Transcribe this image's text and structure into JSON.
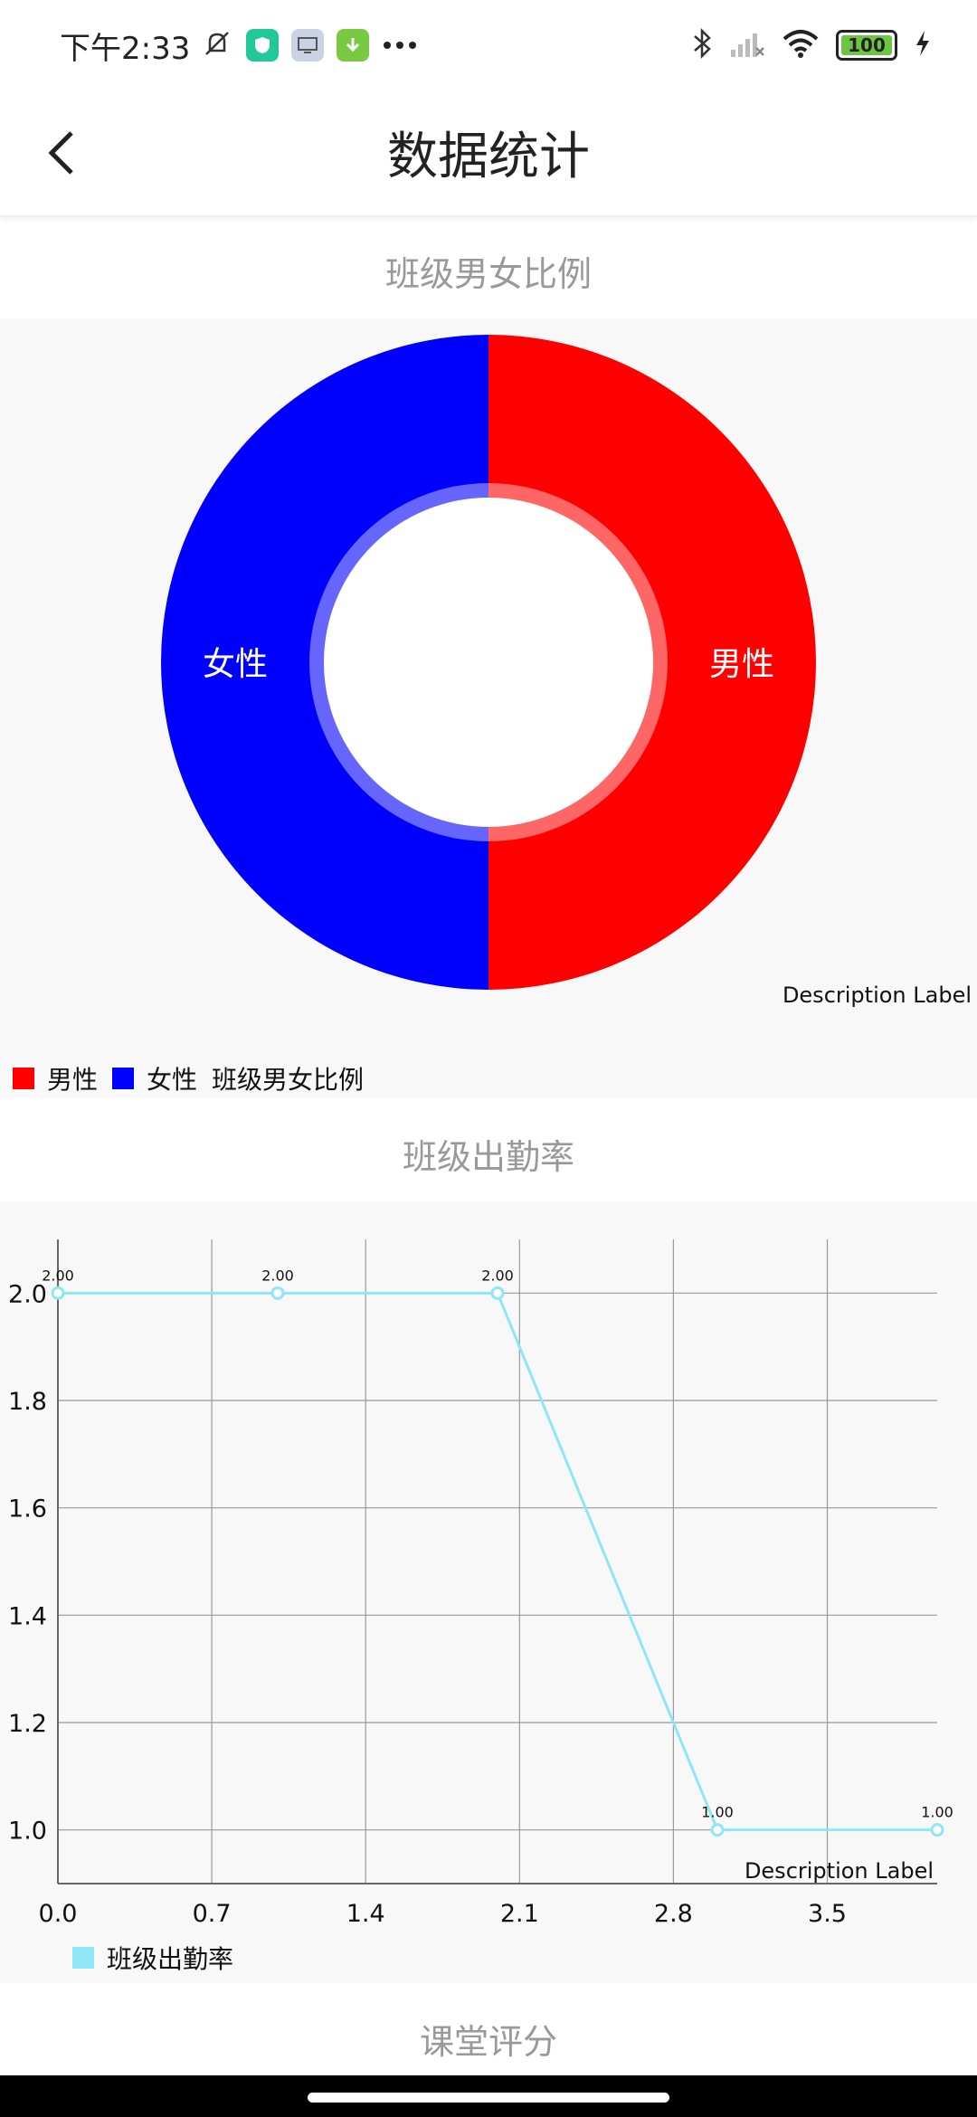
{
  "status_bar": {
    "time": "下午2:33",
    "battery": "100",
    "icons": [
      "mute-bell-icon",
      "shield-app-icon",
      "screen-app-icon",
      "download-app-icon",
      "more-dots-icon",
      "bluetooth-icon",
      "signal-off-icon",
      "wifi-icon",
      "battery-icon",
      "charging-icon"
    ]
  },
  "header": {
    "title": "数据统计",
    "back_icon": "chevron-left-icon"
  },
  "sections": {
    "gender": {
      "title": "班级男女比例"
    },
    "attendance": {
      "title": "班级出勤率"
    },
    "score": {
      "title": "课堂评分"
    }
  },
  "chart_data": [
    {
      "type": "pie",
      "variant": "donut",
      "slices": [
        {
          "label": "男性",
          "value": 1,
          "color": "#ff0000"
        },
        {
          "label": "女性",
          "value": 1,
          "color": "#0000ff"
        }
      ],
      "legend": [
        "男性",
        "女性"
      ],
      "legend_title": "班级男女比例",
      "description": "Description Label",
      "legend_placement": "bottom-left"
    },
    {
      "type": "line",
      "x": [
        0.0,
        1.0,
        2.0,
        3.0,
        4.0
      ],
      "series": [
        {
          "name": "班级出勤率",
          "values": [
            2.0,
            2.0,
            2.0,
            1.0,
            1.0
          ],
          "color": "#8ee6f7"
        }
      ],
      "data_labels": [
        "2.00",
        "2.00",
        "2.00",
        "1.00",
        "1.00"
      ],
      "x_ticks": [
        "0.0",
        "0.7",
        "1.4",
        "2.1",
        "2.8",
        "3.5"
      ],
      "y_ticks": [
        "1.0",
        "1.2",
        "1.4",
        "1.6",
        "1.8",
        "2.0"
      ],
      "xlim": [
        0,
        4.0
      ],
      "ylim": [
        0.9,
        2.1
      ],
      "grid": true,
      "description": "Description Label",
      "legend_placement": "bottom-left"
    }
  ]
}
